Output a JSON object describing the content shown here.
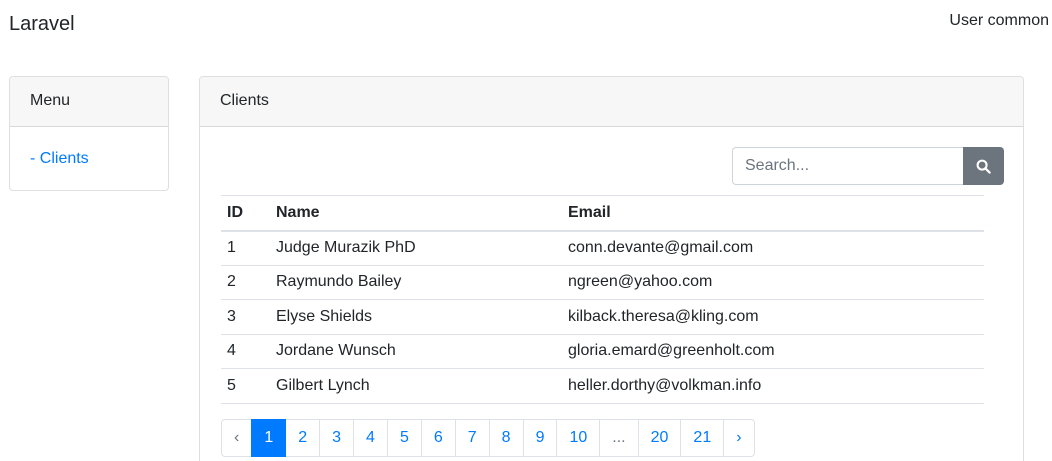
{
  "navbar": {
    "brand": "Laravel",
    "user": "User common"
  },
  "sidebar": {
    "title": "Menu",
    "items": [
      {
        "label": "- Clients"
      }
    ]
  },
  "main": {
    "title": "Clients",
    "search": {
      "placeholder": "Search...",
      "value": "",
      "icon": "search-icon"
    },
    "table": {
      "headers": [
        "ID",
        "Name",
        "Email"
      ],
      "rows": [
        {
          "id": "1",
          "name": "Judge Murazik PhD",
          "email": "conn.devante@gmail.com"
        },
        {
          "id": "2",
          "name": "Raymundo Bailey",
          "email": "ngreen@yahoo.com"
        },
        {
          "id": "3",
          "name": "Elyse Shields",
          "email": "kilback.theresa@kling.com"
        },
        {
          "id": "4",
          "name": "Jordane Wunsch",
          "email": "gloria.emard@greenholt.com"
        },
        {
          "id": "5",
          "name": "Gilbert Lynch",
          "email": "heller.dorthy@volkman.info"
        }
      ]
    },
    "pagination": {
      "prev": "‹",
      "pages": [
        "1",
        "2",
        "3",
        "4",
        "5",
        "6",
        "7",
        "8",
        "9",
        "10",
        "...",
        "20",
        "21"
      ],
      "active": "1",
      "next": "›"
    }
  },
  "colors": {
    "primary": "#007bff",
    "secondary": "#6c757d",
    "header_bg": "#f7f7f7"
  }
}
